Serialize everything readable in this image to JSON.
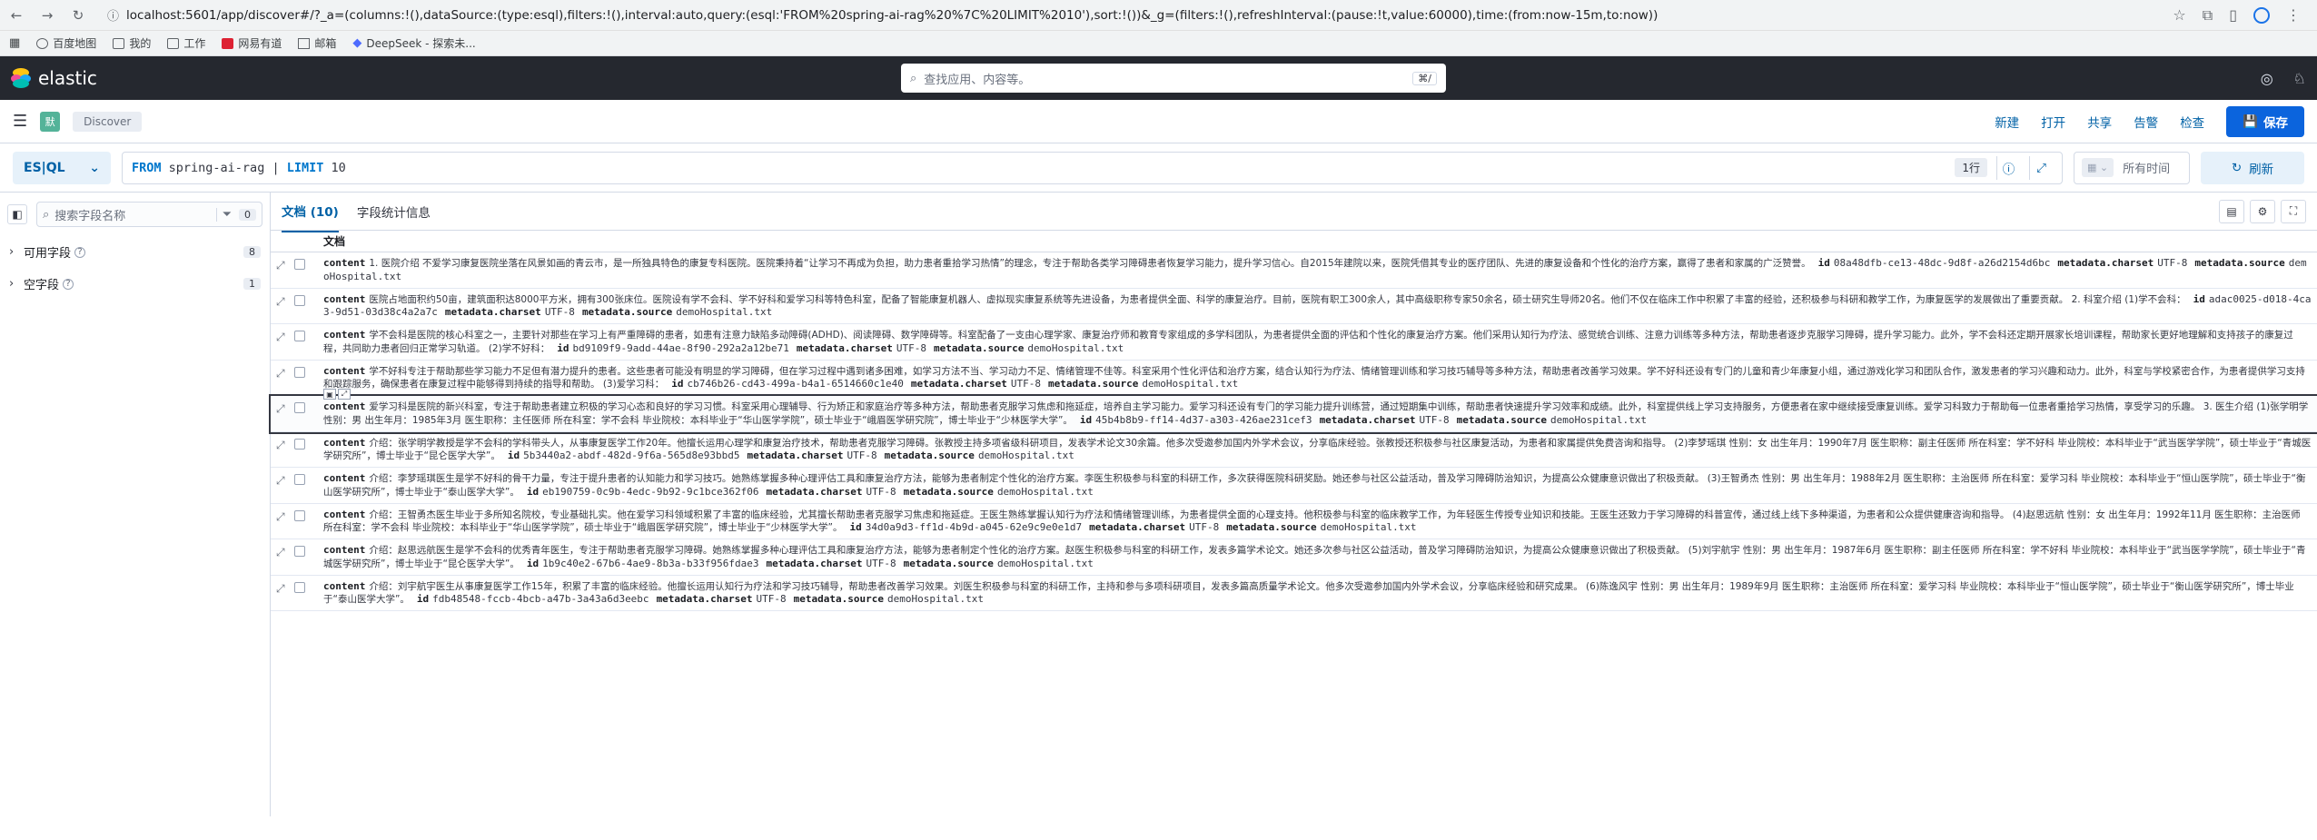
{
  "browser": {
    "url": "localhost:5601/app/discover#/?_a=(columns:!(),dataSource:(type:esql),filters:!(),interval:auto,query:(esql:'FROM%20spring-ai-rag%20%7C%20LIMIT%2010'),sort:!())&_g=(filters:!(),refreshInterval:(pause:!t,value:60000),time:(from:now-15m,to:now))",
    "bookmarks": [
      "百度地图",
      "我的",
      "工作",
      "网易有道",
      "邮箱",
      "DeepSeek - 探索未..."
    ]
  },
  "header": {
    "brand": "elastic",
    "search_placeholder": "查找应用、内容等。",
    "search_shortcut": "⌘/"
  },
  "appbar": {
    "space_initial": "默",
    "breadcrumb": "Discover",
    "actions": [
      "新建",
      "打开",
      "共享",
      "告警",
      "检查"
    ],
    "save_label": "保存"
  },
  "query": {
    "language": "ES|QL",
    "keyword_from": "FROM",
    "index": "spring-ai-rag",
    "pipe": "|",
    "keyword_limit": "LIMIT",
    "limit_value": "10",
    "line_count": "1行",
    "time_label": "所有时间",
    "refresh_label": "刷新"
  },
  "sidebar": {
    "search_placeholder": "搜索字段名称",
    "filter_count": "0",
    "groups": [
      {
        "label": "可用字段",
        "count": "8"
      },
      {
        "label": "空字段",
        "count": "1"
      }
    ]
  },
  "tabs": {
    "documents": "文档 (10)",
    "field_stats": "字段统计信息"
  },
  "grid": {
    "column_header": "文档",
    "rows": [
      {
        "content": "1. 医院介绍 不爱学习康复医院坐落在风景如画的青云市，是一所独具特色的康复专科医院。医院秉持着“让学习不再成为负担，助力患者重拾学习热情”的理念，专注于帮助各类学习障碍患者恢复学习能力，提升学习信心。自2015年建院以来，医院凭借其专业的医疗团队、先进的康复设备和个性化的治疗方案，赢得了患者和家属的广泛赞誉。",
        "id": "08a48dfb-ce13-48dc-9d8f-a26d2154d6bc",
        "charset": "UTF-8",
        "source": "demoHospital.txt"
      },
      {
        "content": "医院占地面积约50亩，建筑面积达8000平方米，拥有300张床位。医院设有学不会科、学不好科和爱学习科等特色科室，配备了智能康复机器人、虚拟现实康复系统等先进设备，为患者提供全面、科学的康复治疗。目前，医院有职工300余人，其中高级职称专家50余名，硕士研究生导师20名。他们不仅在临床工作中积累了丰富的经验，还积极参与科研和教学工作，为康复医学的发展做出了重要贡献。 2. 科室介绍 (1)学不会科：",
        "id": "adac0025-d018-4ca3-9d51-03d38c4a2a7c",
        "charset": "UTF-8",
        "source": "demoHospital.txt"
      },
      {
        "content": "学不会科是医院的核心科室之一，主要针对那些在学习上有严重障碍的患者，如患有注意力缺陷多动障碍(ADHD)、阅读障碍、数学障碍等。科室配备了一支由心理学家、康复治疗师和教育专家组成的多学科团队，为患者提供全面的评估和个性化的康复治疗方案。他们采用认知行为疗法、感觉统合训练、注意力训练等多种方法，帮助患者逐步克服学习障碍，提升学习能力。此外，学不会科还定期开展家长培训课程，帮助家长更好地理解和支持孩子的康复过程，共同助力患者回归正常学习轨道。 (2)学不好科：",
        "id": "bd9109f9-9add-44ae-8f90-292a2a12be71",
        "charset": "UTF-8",
        "source": "demoHospital.txt"
      },
      {
        "content": "学不好科专注于帮助那些学习能力不足但有潜力提升的患者。这些患者可能没有明显的学习障碍，但在学习过程中遇到诸多困难，如学习方法不当、学习动力不足、情绪管理不佳等。科室采用个性化评估和治疗方案，结合认知行为疗法、情绪管理训练和学习技巧辅导等多种方法，帮助患者改善学习效果。学不好科还设有专门的儿童和青少年康复小组，通过游戏化学习和团队合作，激发患者的学习兴趣和动力。此外，科室与学校紧密合作，为患者提供学习支持和跟踪服务，确保患者在康复过程中能够得到持续的指导和帮助。 (3)爱学习科：",
        "id": "cb746b26-cd43-499a-b4a1-6514660c1e40",
        "charset": "UTF-8",
        "source": "demoHospital.txt"
      },
      {
        "content": "爱学习科是医院的新兴科室，专注于帮助患者建立积极的学习心态和良好的学习习惯。科室采用心理辅导、行为矫正和家庭治疗等多种方法，帮助患者克服学习焦虑和拖延症，培养自主学习能力。爱学习科还设有专门的学习能力提升训练营，通过短期集中训练，帮助患者快速提升学习效率和成绩。此外，科室提供线上学习支持服务，方便患者在家中继续接受康复训练。爱学习科致力于帮助每一位患者重拾学习热情，享受学习的乐趣。 3. 医生介绍 (1)张学明学 性别：男 出生年月：1985年3月 医生职称：主任医师 所在科室：学不会科 毕业院校：本科毕业于“华山医学学院”，硕士毕业于“峨眉医学研究院”，博士毕业于“少林医学大学”。",
        "id": "45b4b8b9-ff14-4d37-a303-426ae231cef3",
        "charset": "UTF-8",
        "source": "demoHospital.txt"
      },
      {
        "content": "介绍：张学明学教授是学不会科的学科带头人，从事康复医学工作20年。他擅长运用心理学和康复治疗技术，帮助患者克服学习障碍。张教授主持多项省级科研项目，发表学术论文30余篇。他多次受邀参加国内外学术会议，分享临床经验。张教授还积极参与社区康复活动，为患者和家属提供免费咨询和指导。 (2)李梦瑶琪 性别：女 出生年月：1990年7月 医生职称：副主任医师 所在科室：学不好科 毕业院校：本科毕业于“武当医学学院”，硕士毕业于“青城医学研究所”，博士毕业于“昆仑医学大学”。",
        "id": "5b3440a2-abdf-482d-9f6a-565d8e93bbd5",
        "charset": "UTF-8",
        "source": "demoHospital.txt"
      },
      {
        "content": "介绍：李梦瑶琪医生是学不好科的骨干力量，专注于提升患者的认知能力和学习技巧。她熟练掌握多种心理评估工具和康复治疗方法，能够为患者制定个性化的治疗方案。李医生积极参与科室的科研工作，多次获得医院科研奖励。她还参与社区公益活动，普及学习障碍防治知识，为提高公众健康意识做出了积极贡献。 (3)王智勇杰 性别：男 出生年月：1988年2月 医生职称：主治医师 所在科室：爱学习科 毕业院校：本科毕业于“恒山医学院”，硕士毕业于“衡山医学研究所”，博士毕业于“泰山医学大学”。",
        "id": "eb190759-0c9b-4edc-9b92-9c1bce362f06",
        "charset": "UTF-8",
        "source": "demoHospital.txt"
      },
      {
        "content": "介绍：王智勇杰医生毕业于多所知名院校，专业基础扎实。他在爱学习科领域积累了丰富的临床经验，尤其擅长帮助患者克服学习焦虑和拖延症。王医生熟练掌握认知行为疗法和情绪管理训练，为患者提供全面的心理支持。他积极参与科室的临床教学工作，为年轻医生传授专业知识和技能。王医生还致力于学习障碍的科普宣传，通过线上线下多种渠道，为患者和公众提供健康咨询和指导。 (4)赵思远航 性别：女 出生年月：1992年11月 医生职称：主治医师 所在科室：学不会科 毕业院校：本科毕业于“华山医学学院”，硕士毕业于“峨眉医学研究院”，博士毕业于“少林医学大学”。",
        "id": "34d0a9d3-ff1d-4b9d-a045-62e9c9e0e1d7",
        "charset": "UTF-8",
        "source": "demoHospital.txt"
      },
      {
        "content": "介绍：赵思远航医生是学不会科的优秀青年医生，专注于帮助患者克服学习障碍。她熟练掌握多种心理评估工具和康复治疗方法，能够为患者制定个性化的治疗方案。赵医生积极参与科室的科研工作，发表多篇学术论文。她还多次参与社区公益活动，普及学习障碍防治知识，为提高公众健康意识做出了积极贡献。 (5)刘宇航宇 性别：男 出生年月：1987年6月 医生职称：副主任医师 所在科室：学不好科 毕业院校：本科毕业于“武当医学学院”，硕士毕业于“青城医学研究所”，博士毕业于“昆仑医学大学”。",
        "id": "1b9c40e2-67b6-4ae9-8b3a-b33f956fdae3",
        "charset": "UTF-8",
        "source": "demoHospital.txt"
      },
      {
        "content": "介绍：刘宇航宇医生从事康复医学工作15年，积累了丰富的临床经验。他擅长运用认知行为疗法和学习技巧辅导，帮助患者改善学习效果。刘医生积极参与科室的科研工作，主持和参与多项科研项目，发表多篇高质量学术论文。他多次受邀参加国内外学术会议，分享临床经验和研究成果。 (6)陈逸风宇 性别：男 出生年月：1989年9月 医生职称：主治医师 所在科室：爱学习科 毕业院校：本科毕业于“恒山医学院”，硕士毕业于“衡山医学研究所”，博士毕业于“泰山医学大学”。",
        "id": "fdb48548-fccb-4bcb-a47b-3a43a6d3eebc",
        "charset": "UTF-8",
        "source": "demoHospital.txt"
      }
    ]
  }
}
